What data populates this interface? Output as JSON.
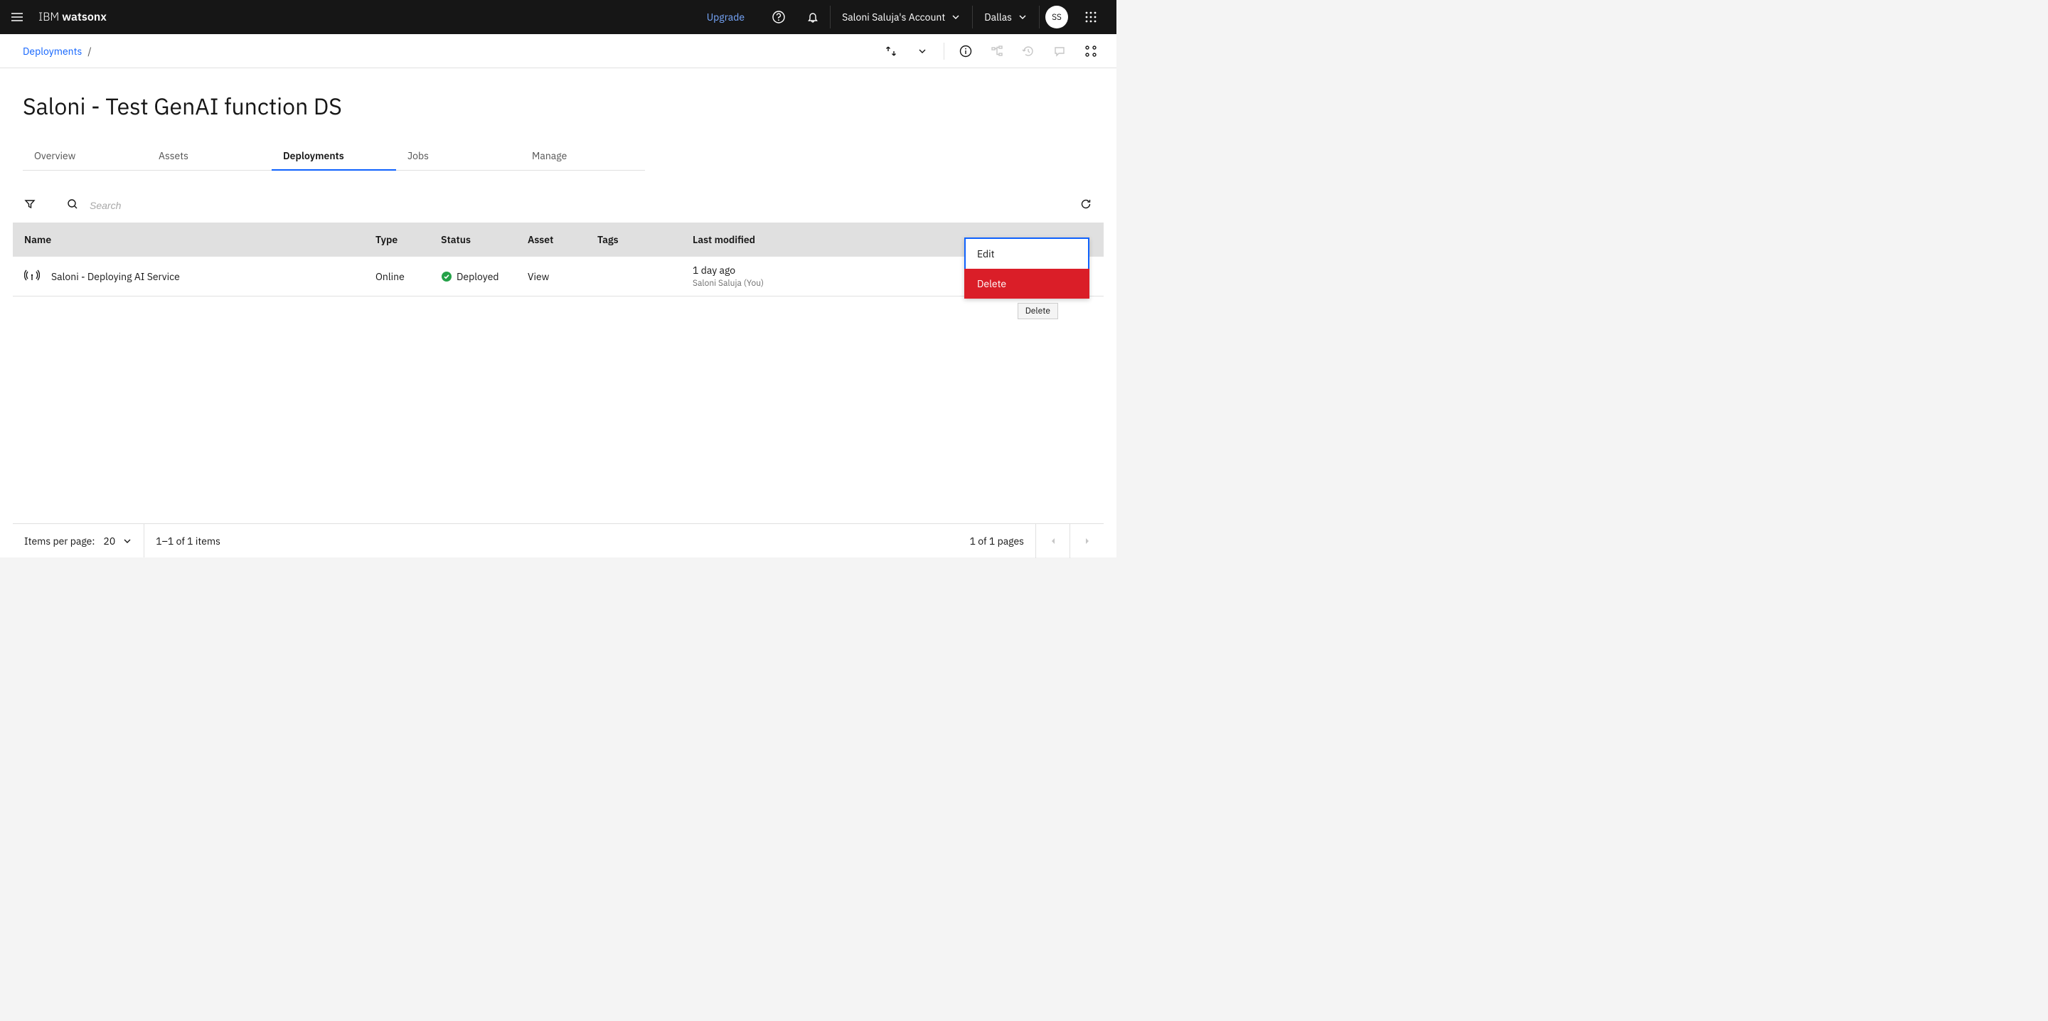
{
  "header": {
    "brand_prefix": "IBM ",
    "brand_bold": "watsonx",
    "upgrade": "Upgrade",
    "account": "Saloni Saluja's Account",
    "region": "Dallas",
    "avatar_initials": "SS"
  },
  "breadcrumb": {
    "items": [
      "Deployments"
    ]
  },
  "page_title": "Saloni - Test GenAI function DS",
  "tabs": [
    {
      "label": "Overview",
      "active": false
    },
    {
      "label": "Assets",
      "active": false
    },
    {
      "label": "Deployments",
      "active": true
    },
    {
      "label": "Jobs",
      "active": false
    },
    {
      "label": "Manage",
      "active": false
    }
  ],
  "search": {
    "placeholder": "Search"
  },
  "columns": {
    "name": "Name",
    "type": "Type",
    "status": "Status",
    "asset": "Asset",
    "tags": "Tags",
    "last_modified": "Last modified"
  },
  "rows": [
    {
      "name": "Saloni - Deploying AI Service",
      "type": "Online",
      "status": "Deployed",
      "asset": "View",
      "tags": "",
      "last_modified": "1 day ago",
      "last_modified_by": "Saloni Saluja (You)"
    }
  ],
  "context_menu": {
    "edit": "Edit",
    "delete": "Delete",
    "tooltip": "Delete"
  },
  "pagination": {
    "items_per_page_label": "Items per page:",
    "items_per_page_value": "20",
    "range_text": "1–1 of 1 items",
    "pages_text": "1 of 1 pages"
  }
}
